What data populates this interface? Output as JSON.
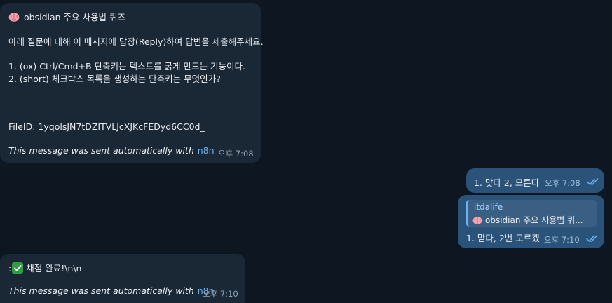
{
  "messages": {
    "quiz": {
      "title": "obsidian 주요 사용법 퀴즈",
      "instruction": "아래 질문에 대해 이 메시지에 답장(Reply)하여 답변을 제출해주세요.",
      "q1": "1. (ox) Ctrl/Cmd+B 단축키는 텍스트를 굵게 만드는 기능이다.",
      "q2": "2. (short) 체크박스 목록을 생성하는 단축키는 무엇인가?",
      "separator": "---",
      "file_id": "FileID: 1yqolsJN7tDZITVLJcXJKcFEDyd6CC0d_",
      "footer": "This message was sent automatically with",
      "footer_link": "n8n",
      "time": "오후 7:08",
      "icon": "brain-icon"
    },
    "answer1": {
      "text": "1. 맞다 2, 모른다",
      "time": "오후 7:08",
      "status_icon": "double-check-icon"
    },
    "answer2": {
      "reply_author": "itdalife",
      "reply_snippet": "obsidian 주요 사용법 퀴...",
      "text": "1. 맏다, 2번 모르겠",
      "time": "오후 7:10",
      "status_icon": "double-check-icon"
    },
    "result": {
      "prefix": ":",
      "text": "채점 완료!\\n\\n",
      "footer": "This message was sent automatically with",
      "footer_link": "n8n",
      "time": "오후 7:10",
      "icon": "green-check-icon"
    }
  },
  "colors": {
    "background": "#0e1621",
    "incoming_bubble": "#1a2735",
    "outgoing_bubble": "#2b5278",
    "link": "#6ab3f3",
    "timestamp": "#8fa4b7"
  }
}
